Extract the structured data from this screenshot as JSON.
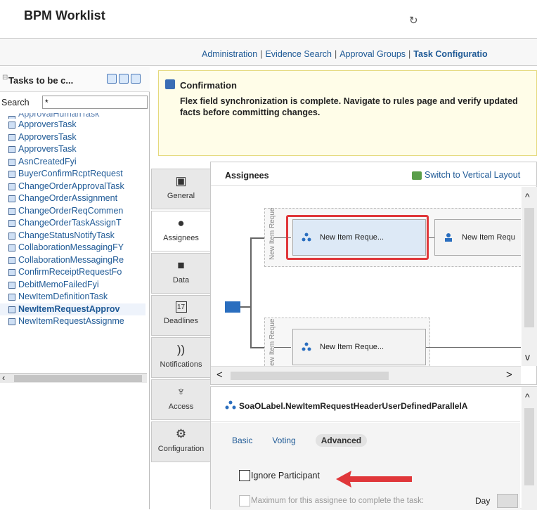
{
  "app": {
    "title": "BPM Worklist"
  },
  "nav": {
    "links": [
      "Administration",
      "Evidence Search",
      "Approval Groups"
    ],
    "active_link": "Task Configuratio"
  },
  "left_panel": {
    "title": "Tasks to be c...",
    "search_label": "Search",
    "search_value": "*",
    "tasks": [
      "ApprovalHumanTask",
      "ApproversTask",
      "ApproversTask",
      "ApproversTask",
      "AsnCreatedFyi",
      "BuyerConfirmRcptRequest",
      "ChangeOrderApprovalTask",
      "ChangeOrderAssignment",
      "ChangeOrderReqCommen",
      "ChangeOrderTaskAssignT",
      "ChangeStatusNotifyTask",
      "CollaborationMessagingFY",
      "CollaborationMessagingRe",
      "ConfirmReceiptRequestFo",
      "DebitMemoFailedFyi",
      "NewItemDefinitionTask",
      "NewItemRequestApprov",
      "NewItemRequestAssignme"
    ],
    "selected_index": 16
  },
  "confirmation": {
    "title": "Confirmation",
    "message": "Flex field synchronization is complete. Navigate to rules page and verify updated facts before committing changes."
  },
  "vertical_tabs": [
    {
      "label": "General",
      "icon": "clipboard-icon"
    },
    {
      "label": "Assignees",
      "icon": "person-icon"
    },
    {
      "label": "Data",
      "icon": "briefcase-icon"
    },
    {
      "label": "Deadlines",
      "icon": "calendar-icon"
    },
    {
      "label": "Notifications",
      "icon": "rss-icon"
    },
    {
      "label": "Access",
      "icon": "key-icon"
    },
    {
      "label": "Configuration",
      "icon": "gear-icon"
    }
  ],
  "calendar_day": "17",
  "assignees": {
    "title": "Assignees",
    "switch_layout": "Switch to Vertical Layout",
    "lane_label_1": "New Item Reque",
    "lane_label_2": "New Item Reque",
    "node_1": "New Item Reque...",
    "node_2": "New Item Requ",
    "node_3": "New Item Reque..."
  },
  "detail": {
    "title": "SoaOLabel.NewItemRequestHeaderUserDefinedParallelA",
    "subtabs": [
      "Basic",
      "Voting",
      "Advanced"
    ],
    "active_subtab": "Advanced",
    "ignore_participant": "Ignore Participant",
    "max_label": "Maximum for this assignee to complete the task:",
    "day_label": "Day"
  },
  "colors": {
    "link": "#1f5a96",
    "highlight": "#e0373a",
    "confirm_bg": "#fffde8"
  }
}
